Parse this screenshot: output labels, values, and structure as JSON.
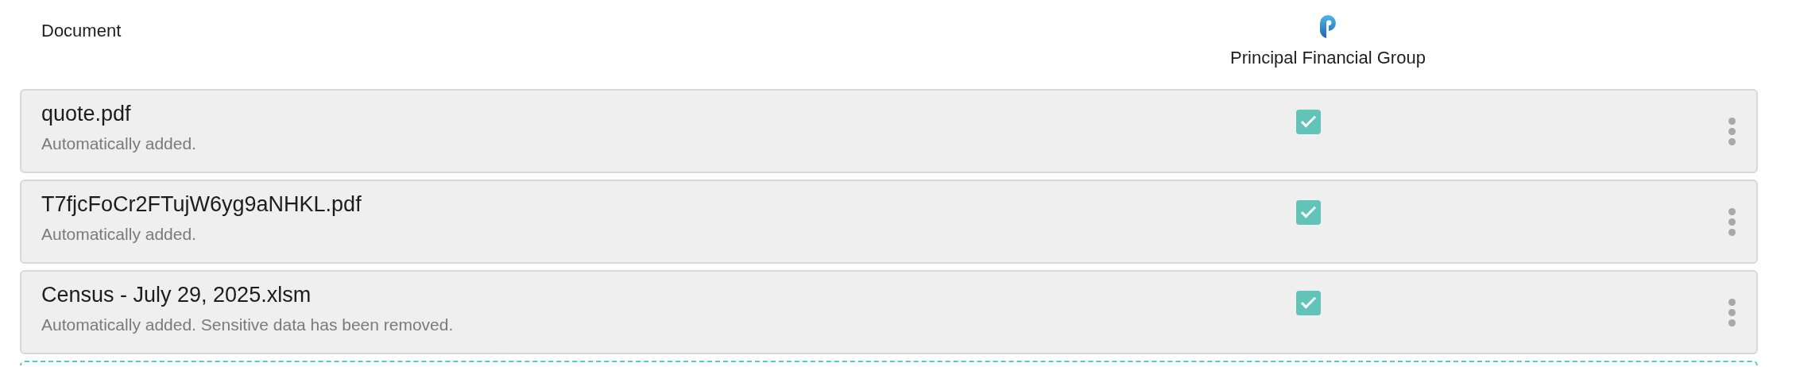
{
  "columns": [
    {
      "label": "Document"
    },
    {
      "label": "Principal Financial Group",
      "kind": "carrier"
    }
  ],
  "documents": [
    {
      "name": "quote.pdf",
      "note": "Automatically added.",
      "checked": true
    },
    {
      "name": "T7fjcFoCr2FTujW6yg9aNHKL.pdf",
      "note": "Automatically added.",
      "checked": true
    },
    {
      "name": "Census - July 29, 2025.xlsm",
      "note": "Automatically added. Sensitive data has been removed.",
      "checked": true
    }
  ]
}
